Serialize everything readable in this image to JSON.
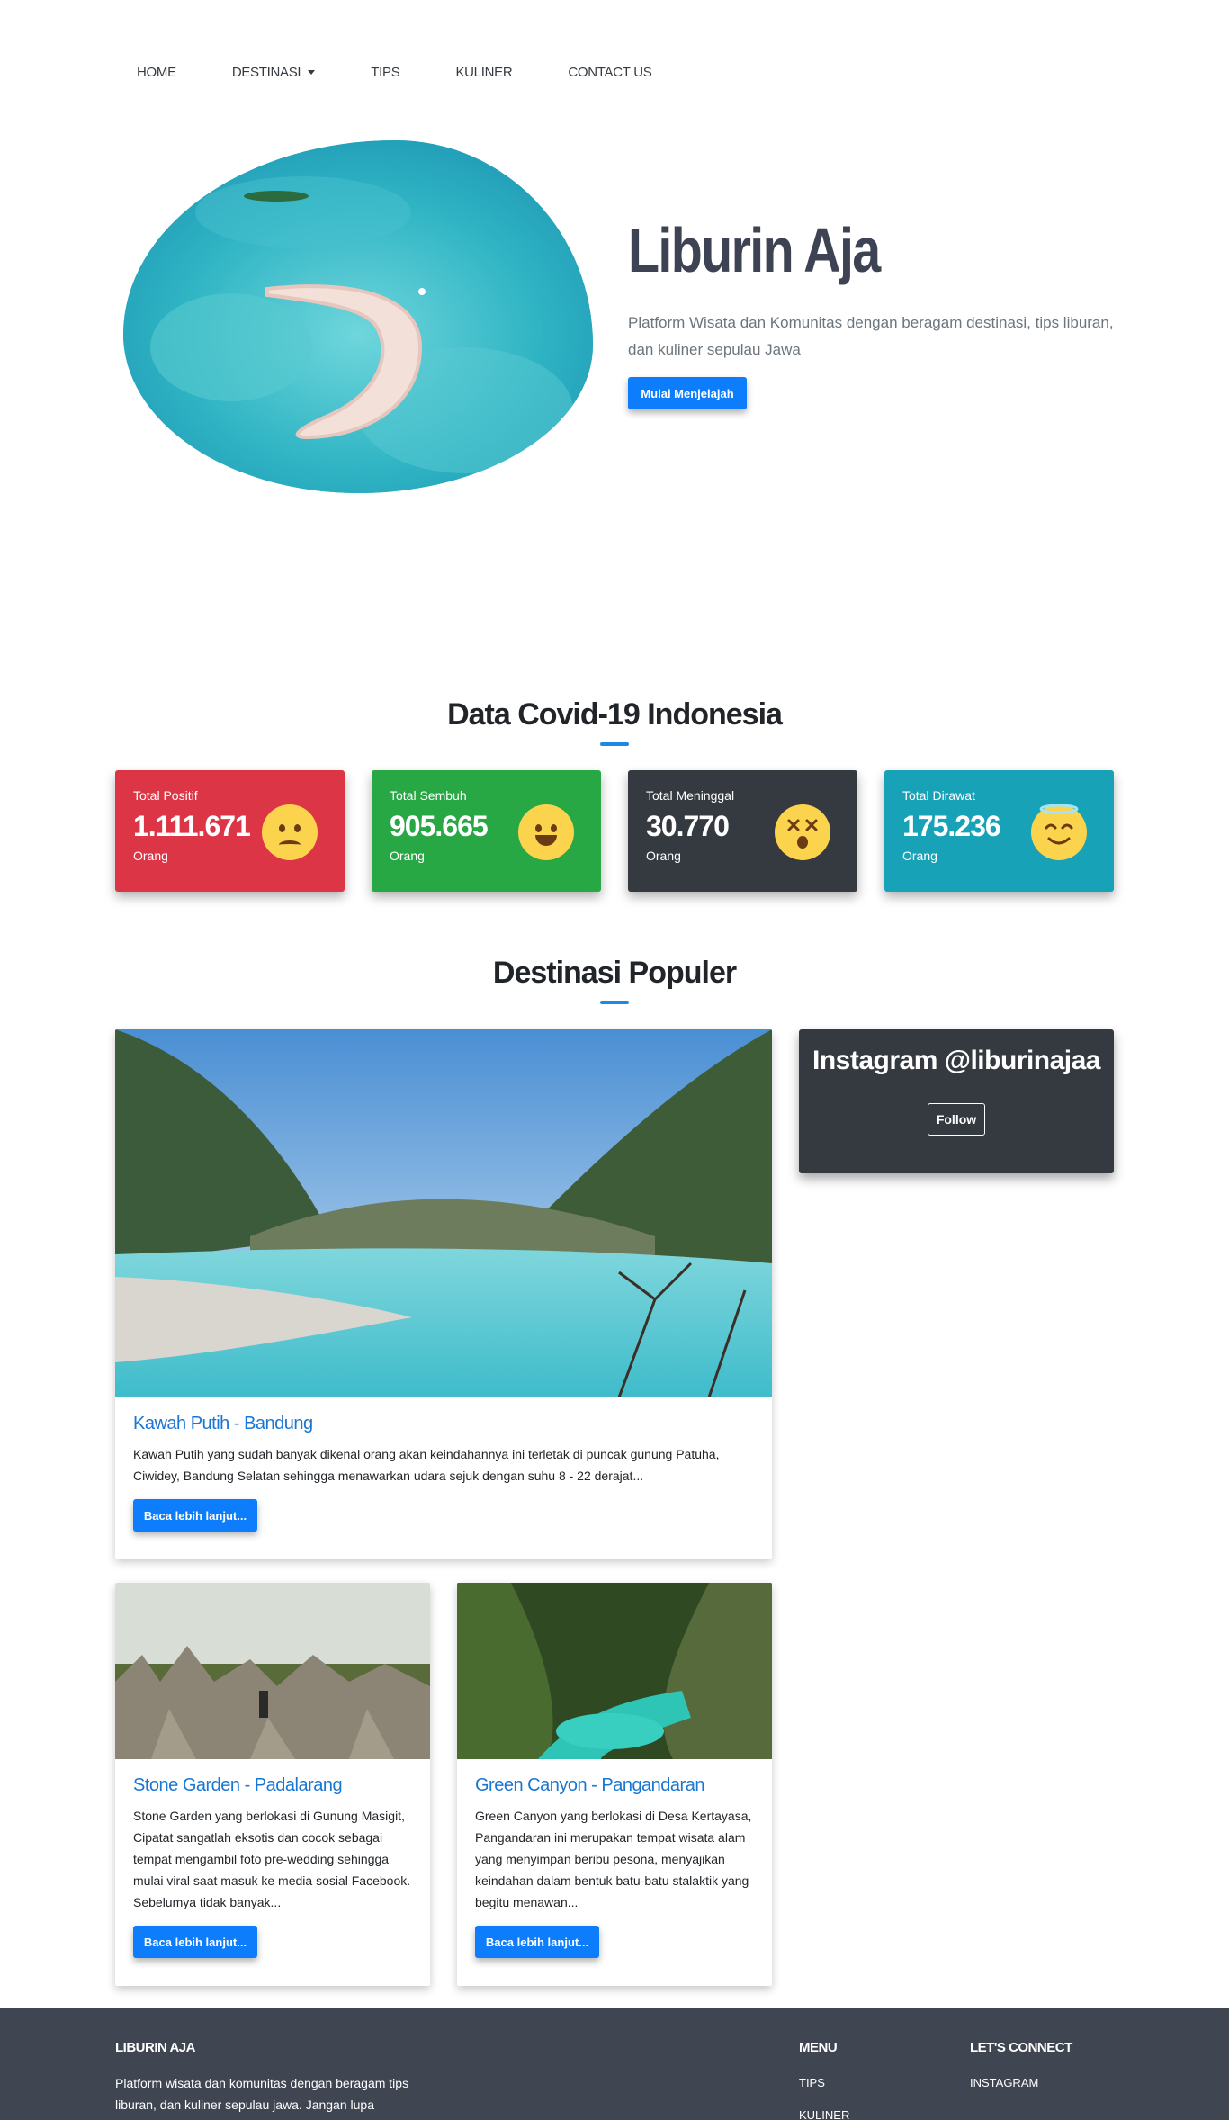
{
  "nav": {
    "items": [
      "HOME",
      "DESTINASI",
      "TIPS",
      "KULINER",
      "CONTACT US"
    ]
  },
  "hero": {
    "title": "Liburin Aja",
    "description": "Platform Wisata dan Komunitas dengan beragam destinasi, tips liburan, dan kuliner sepulau Jawa",
    "button": "Mulai Menjelajah"
  },
  "covid": {
    "title": "Data Covid-19 Indonesia",
    "cards": [
      {
        "label": "Total Positif",
        "value": "1.111.671",
        "unit": "Orang",
        "color": "#dc3545",
        "emoji": "sad-face-icon"
      },
      {
        "label": "Total Sembuh",
        "value": "905.665",
        "unit": "Orang",
        "color": "#28a745",
        "emoji": "happy-face-icon"
      },
      {
        "label": "Total Meninggal",
        "value": "30.770",
        "unit": "Orang",
        "color": "#343a40",
        "emoji": "dizzy-face-icon"
      },
      {
        "label": "Total Dirawat",
        "value": "175.236",
        "unit": "Orang",
        "color": "#17a2b8",
        "emoji": "halo-face-icon"
      }
    ]
  },
  "destinations": {
    "title": "Destinasi Populer",
    "items": [
      {
        "title": "Kawah Putih - Bandung",
        "text": "Kawah Putih yang sudah banyak dikenal orang akan keindahannya ini terletak di puncak gunung Patuha, Ciwidey, Bandung Selatan sehingga menawarkan udara sejuk dengan suhu 8 - 22 derajat...",
        "button": "Baca lebih lanjut..."
      },
      {
        "title": "Stone Garden - Padalarang",
        "text": "Stone Garden yang berlokasi di Gunung Masigit, Cipatat sangatlah eksotis dan cocok sebagai tempat mengambil foto pre-wedding sehingga mulai viral saat masuk ke media sosial Facebook. Sebelumya tidak banyak...",
        "button": "Baca lebih lanjut..."
      },
      {
        "title": "Green Canyon - Pangandaran",
        "text": "Green Canyon yang berlokasi di Desa Kertayasa, Pangandaran ini merupakan tempat wisata alam yang menyimpan beribu pesona, menyajikan keindahan dalam bentuk batu-batu stalaktik yang begitu menawan...",
        "button": "Baca lebih lanjut..."
      }
    ]
  },
  "instagram": {
    "title": "Instagram @liburinajaa",
    "button": "Follow"
  },
  "footer": {
    "brand": "LIBURIN AJA",
    "description": "Platform wisata dan komunitas dengan beragam tips liburan, dan kuliner sepulau jawa. Jangan lupa Subscribe & Like agar",
    "menu_heading": "MENU",
    "menu_items": [
      "TIPS",
      "KULINER"
    ],
    "connect_heading": "LET'S CONNECT",
    "connect_items": [
      "INSTAGRAM"
    ]
  }
}
